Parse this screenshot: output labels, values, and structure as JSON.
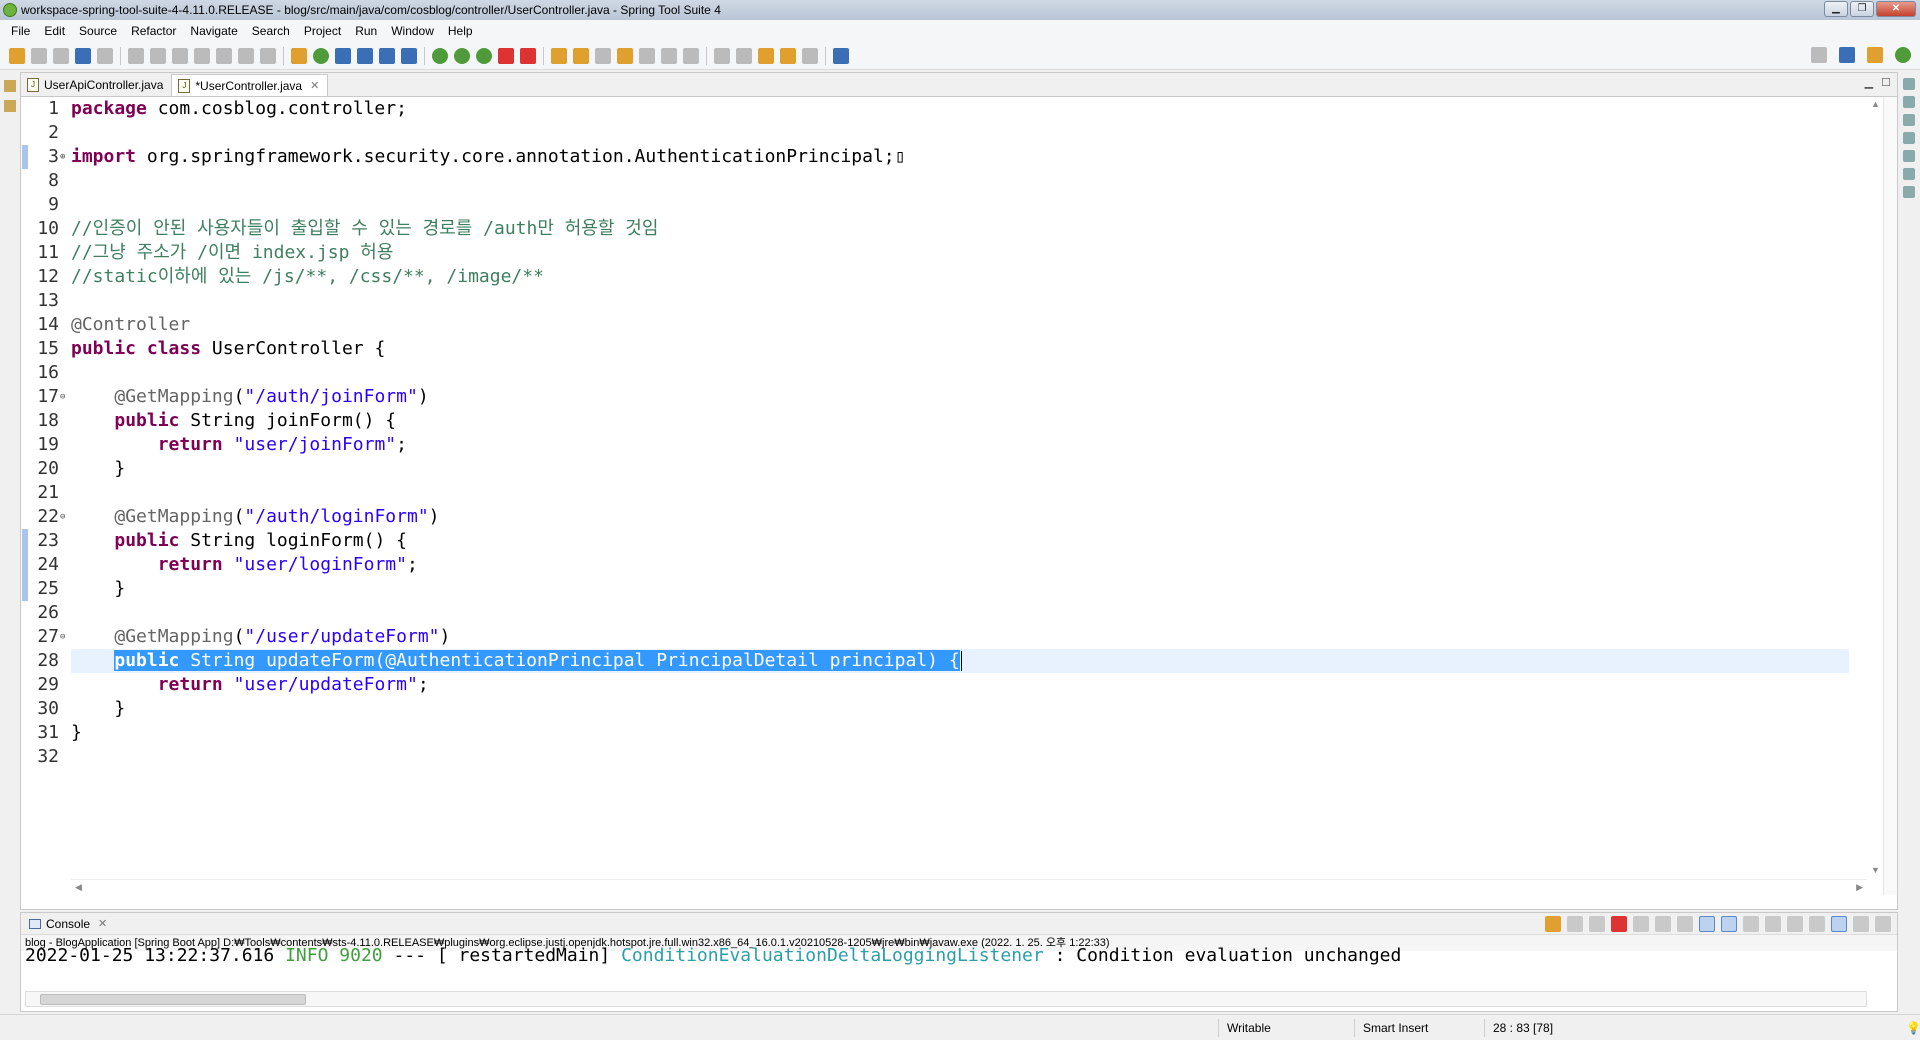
{
  "window": {
    "title": "workspace-spring-tool-suite-4-4.11.0.RELEASE - blog/src/main/java/com/cosblog/controller/UserController.java - Spring Tool Suite 4",
    "minimize": "▁",
    "maximize": "❐",
    "close": "✕"
  },
  "menu": [
    "File",
    "Edit",
    "Source",
    "Refactor",
    "Navigate",
    "Search",
    "Project",
    "Run",
    "Window",
    "Help"
  ],
  "tabs": [
    {
      "label": "UserApiController.java",
      "active": false
    },
    {
      "label": "*UserController.java",
      "active": true
    }
  ],
  "editor": {
    "lines": [
      {
        "n": "1",
        "html": "<span class=\"kw\">package</span> com.cosblog.controller;"
      },
      {
        "n": "2",
        "html": ""
      },
      {
        "n": "3",
        "fold": "+",
        "html": "<span class=\"kw\">import</span> org.springframework.security.core.annotation.AuthenticationPrincipal;▯"
      },
      {
        "n": "8",
        "html": ""
      },
      {
        "n": "9",
        "html": ""
      },
      {
        "n": "10",
        "html": "<span class=\"cmt\">//인증이 안된 사용자들이 출입할 수 있는 경로를 /auth만 허용할 것임</span>"
      },
      {
        "n": "11",
        "html": "<span class=\"cmt\">//그냥 주소가 /이면 index.jsp 허용</span>"
      },
      {
        "n": "12",
        "html": "<span class=\"cmt\">//static이하에 있는 /js/**, /css/**, /image/**</span>"
      },
      {
        "n": "13",
        "html": ""
      },
      {
        "n": "14",
        "html": "<span class=\"ann\">@Controller</span>"
      },
      {
        "n": "15",
        "html": "<span class=\"kw\">public</span> <span class=\"kw\">class</span> UserController {"
      },
      {
        "n": "16",
        "html": ""
      },
      {
        "n": "17",
        "fold": "−",
        "html": "    <span class=\"ann\">@GetMapping</span>(<span class=\"str\">\"/auth/joinForm\"</span>)"
      },
      {
        "n": "18",
        "html": "    <span class=\"kw\">public</span> String joinForm() {"
      },
      {
        "n": "19",
        "html": "        <span class=\"kw\">return</span> <span class=\"str\">\"user/joinForm\"</span>;"
      },
      {
        "n": "20",
        "html": "    }"
      },
      {
        "n": "21",
        "html": ""
      },
      {
        "n": "22",
        "fold": "−",
        "html": "    <span class=\"ann\">@GetMapping</span>(<span class=\"str\">\"/auth/loginForm\"</span>)"
      },
      {
        "n": "23",
        "html": "    <span class=\"kw\">public</span> String loginForm() {"
      },
      {
        "n": "24",
        "html": "        <span class=\"kw\">return</span> <span class=\"str\">\"user/loginForm\"</span>;"
      },
      {
        "n": "25",
        "html": "    }"
      },
      {
        "n": "26",
        "html": ""
      },
      {
        "n": "27",
        "fold": "−",
        "html": "    <span class=\"ann\">@GetMapping</span>(<span class=\"str\">\"/user/updateForm\"</span>)"
      },
      {
        "n": "28",
        "current": true,
        "html": "    <span class=\"sel\"><span class=\"kw\">public</span> String updateForm(<span class=\"ann\">@AuthenticationPrincipal</span> PrincipalDetail principal) {</span><span class=\"caret\"></span>"
      },
      {
        "n": "29",
        "html": "        <span class=\"kw\">return</span> <span class=\"str\">\"user/updateForm\"</span>;"
      },
      {
        "n": "30",
        "html": "    }"
      },
      {
        "n": "31",
        "html": "}"
      },
      {
        "n": "32",
        "html": ""
      }
    ]
  },
  "console": {
    "tab_label": "Console",
    "launch": "blog - BlogApplication [Spring Boot App] D:₩Tools₩contents₩sts-4.11.0.RELEASE₩plugins₩org.eclipse.justj.openjdk.hotspot.jre.full.win32.x86_64_16.0.1.v20210528-1205₩jre₩bin₩javaw.exe  (2022. 1. 25. 오후 1:22:33)",
    "output_date": "2022-01-25 13:22:37.616",
    "output_level": "INFO 9020",
    "output_thread": "---  [  restartedMain]",
    "output_class": "ConditionEvaluationDeltaLoggingListener",
    "output_msg": ": Condition evaluation unchanged"
  },
  "status": {
    "writable": "Writable",
    "insert_mode": "Smart Insert",
    "position": "28 : 83 [78]"
  },
  "colors": {
    "keyword": "#7f0055",
    "string": "#2a00ff",
    "comment": "#3f7f5f",
    "selection": "#3399ff"
  }
}
